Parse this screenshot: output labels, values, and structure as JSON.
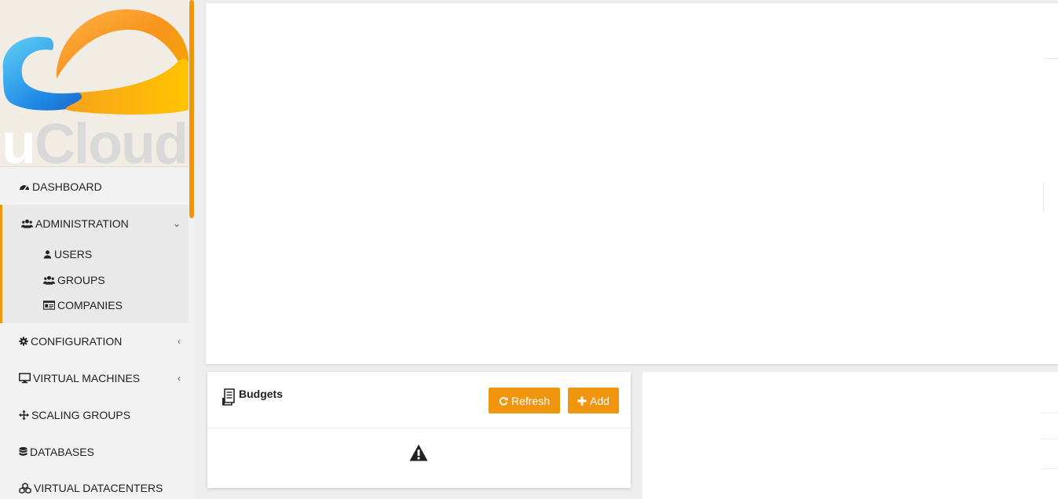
{
  "brand": {
    "logo_text": "uCloud"
  },
  "menu": {
    "dashboard": "DASHBOARD",
    "administration": "ADMINISTRATION",
    "users": "USERS",
    "groups": "GROUPS",
    "companies": "COMPANIES",
    "configuration": "CONFIGURATION",
    "virtual_machines": "VIRTUAL MACHINES",
    "scaling_groups": "SCALING GROUPS",
    "databases": "DATABASES",
    "virtual_datacenters": "VIRTUAL DATACENTERS"
  },
  "budgets": {
    "title": "Budgets",
    "refresh_label": "Refresh",
    "add_label": "Add"
  },
  "colors": {
    "accent": "#f0960e"
  }
}
